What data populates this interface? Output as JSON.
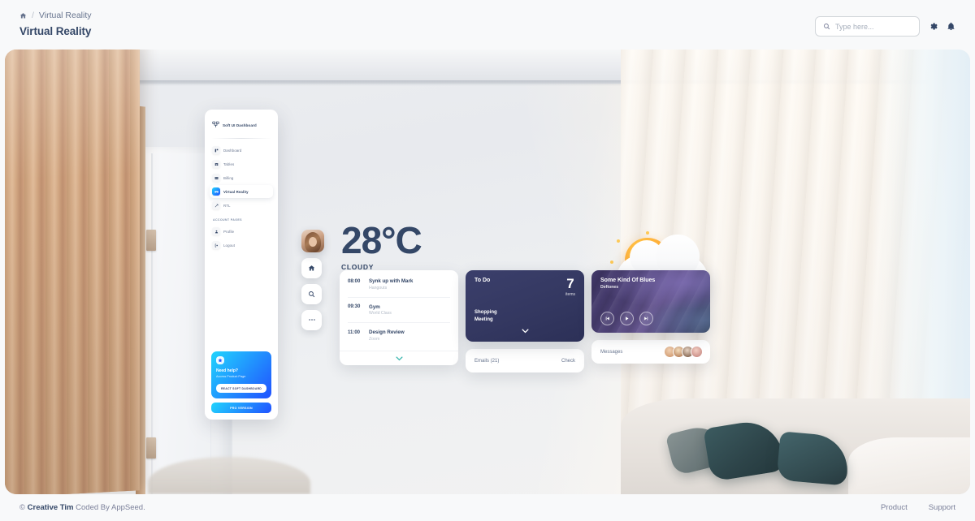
{
  "topnav": {
    "breadcrumb": {
      "home_icon": "home-icon",
      "separator": "/",
      "current": "Virtual Reality"
    },
    "page_title": "Virtual Reality",
    "search": {
      "icon": "search-icon",
      "placeholder": "Type here...",
      "value": ""
    },
    "settings_icon": "gear-icon",
    "notifications_icon": "bell-icon"
  },
  "vr": {
    "mini_sidebar": {
      "brand": "Soft UI Dashboard",
      "brand_icon": "shop-icon",
      "items": [
        {
          "label": "Dashboard",
          "icon": "dashboard-icon",
          "active": false
        },
        {
          "label": "Tables",
          "icon": "tables-icon",
          "active": false
        },
        {
          "label": "Billing",
          "icon": "billing-icon",
          "active": false
        },
        {
          "label": "Virtual Reality",
          "icon": "vr-icon",
          "active": true
        },
        {
          "label": "RTL",
          "icon": "rtl-icon",
          "active": false
        }
      ],
      "section_label": "ACCOUNT PAGES",
      "account_items": [
        {
          "label": "Profile",
          "icon": "profile-icon"
        },
        {
          "label": "Logout",
          "icon": "logout-icon"
        }
      ],
      "help_card": {
        "icon": "star-icon",
        "title": "Need help?",
        "subtitle": "Access Product Page",
        "button": "REACT SOFT DASHBOARD"
      },
      "pro_button": "PRO VERSION"
    },
    "rail": {
      "avatar": "user-avatar",
      "buttons": [
        {
          "icon": "home-icon"
        },
        {
          "icon": "search-icon"
        },
        {
          "icon": "more-icon"
        }
      ]
    },
    "weather": {
      "temperature": "28°C",
      "condition": "CLOUDY",
      "graphic": "sun-behind-cloud-icon"
    },
    "schedule": {
      "items": [
        {
          "time": "08:00",
          "title": "Synk up with Mark",
          "subtitle": "Hangouts"
        },
        {
          "time": "09:30",
          "title": "Gym",
          "subtitle": "World Class"
        },
        {
          "time": "11:00",
          "title": "Design Review",
          "subtitle": "Zoom"
        }
      ],
      "expand_icon": "chevron-down-icon"
    },
    "todo": {
      "title": "To Do",
      "count": "7",
      "count_unit": "items",
      "items": [
        "Shopping",
        "Meeting"
      ],
      "expand_icon": "chevron-down-icon"
    },
    "emails": {
      "label": "Emails (21)",
      "action": "Check"
    },
    "music": {
      "title": "Some Kind Of Blues",
      "artist": "Deftones",
      "controls": [
        {
          "icon": "skip-previous-icon"
        },
        {
          "icon": "play-icon"
        },
        {
          "icon": "skip-next-icon"
        }
      ]
    },
    "messages": {
      "label": "Messages",
      "avatar_count": 4
    }
  },
  "footer": {
    "copyright_symbol": "©",
    "brand": "Creative Tim",
    "credit": "Coded By AppSeed.",
    "links": [
      {
        "label": "Product"
      },
      {
        "label": "Support"
      }
    ]
  },
  "colors": {
    "page_bg": "#f8f9fa",
    "text_dark": "#344767",
    "text_muted": "#67748e",
    "accent_gradient_start": "#21d4fd",
    "accent_gradient_end": "#2152ff",
    "todo_card": "#343861"
  }
}
